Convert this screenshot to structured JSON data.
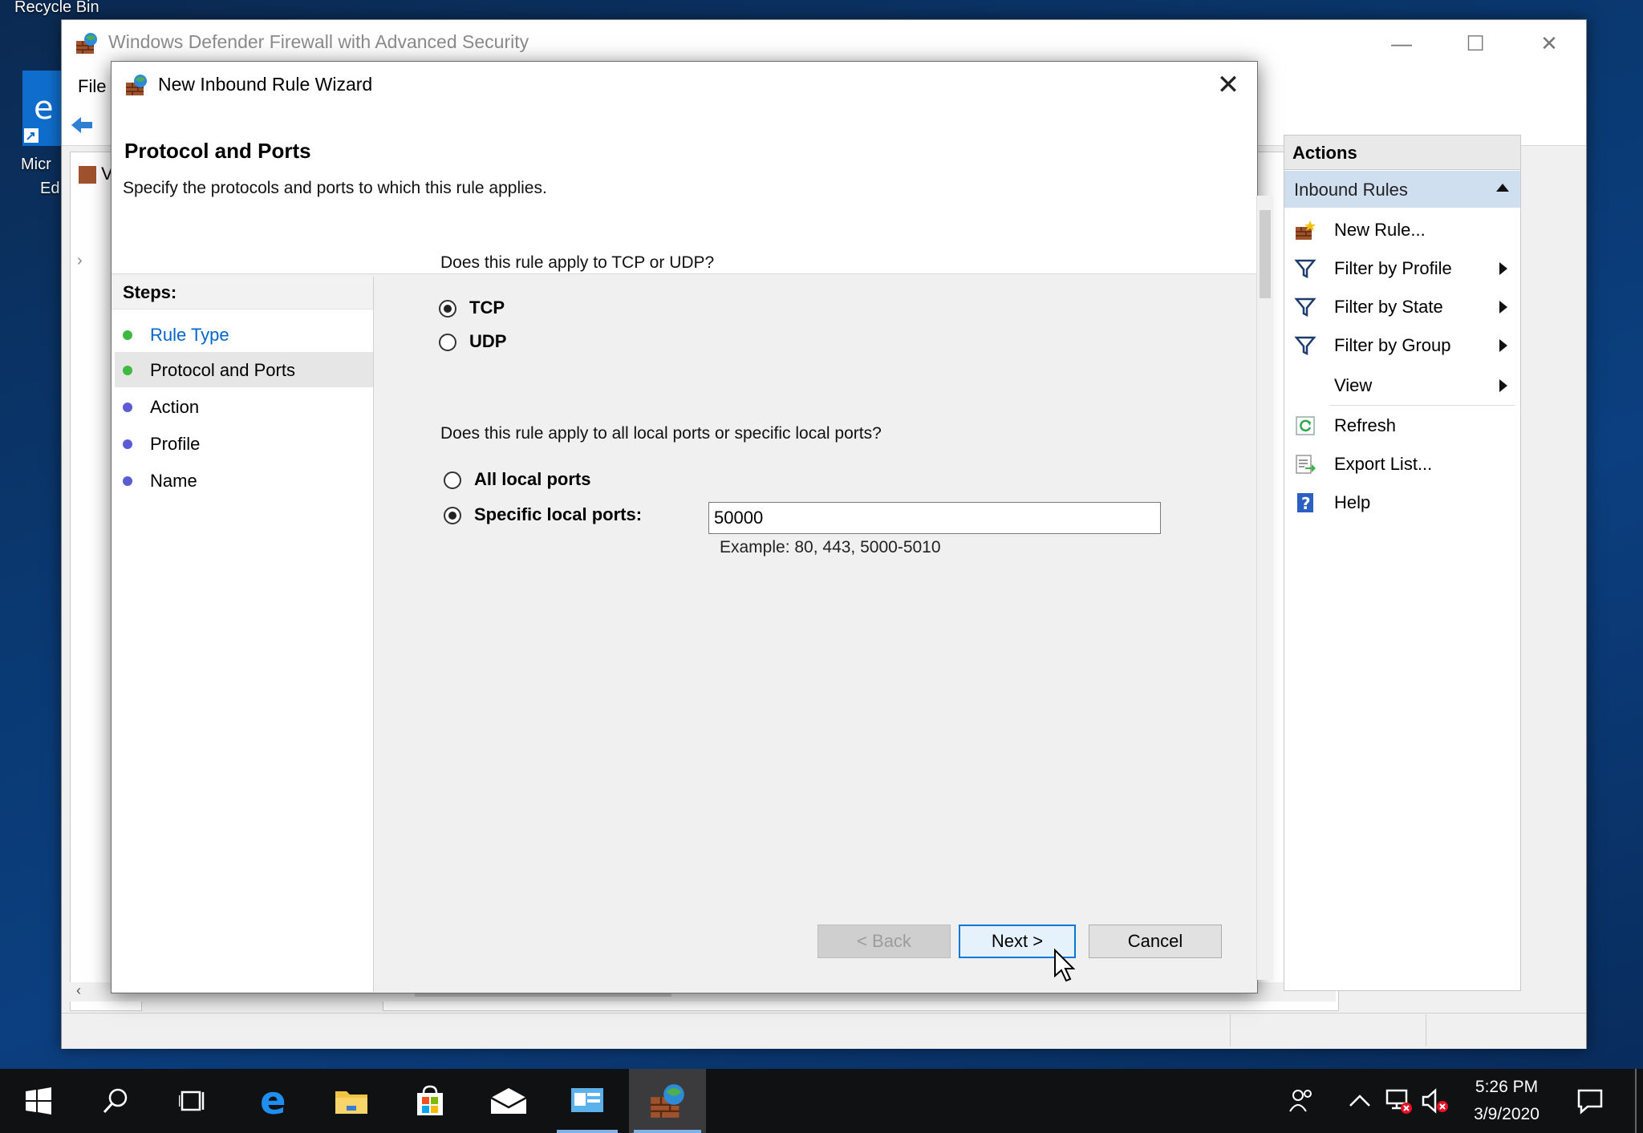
{
  "desktop": {
    "recycle_bin_label": "Recycle Bin",
    "edge_label_line1": "Micr",
    "edge_label_line2": "Ed"
  },
  "main_window": {
    "title": "Windows Defender Firewall with Advanced Security",
    "menu_file": "File",
    "tree_item_letter": "V"
  },
  "actions": {
    "header": "Actions",
    "section": "Inbound Rules",
    "items": [
      {
        "label": "New Rule...",
        "icon": "new-rule-icon",
        "submenu": false
      },
      {
        "label": "Filter by Profile",
        "icon": "funnel-icon",
        "submenu": true
      },
      {
        "label": "Filter by State",
        "icon": "funnel-icon",
        "submenu": true
      },
      {
        "label": "Filter by Group",
        "icon": "funnel-icon",
        "submenu": true
      },
      {
        "label": "View",
        "icon": "",
        "submenu": true
      },
      {
        "label": "Refresh",
        "icon": "refresh-icon",
        "submenu": false
      },
      {
        "label": "Export List...",
        "icon": "export-icon",
        "submenu": false
      },
      {
        "label": "Help",
        "icon": "help-icon",
        "submenu": false
      }
    ]
  },
  "wizard": {
    "title": "New Inbound Rule Wizard",
    "heading": "Protocol and Ports",
    "subheading": "Specify the protocols and ports to which this rule applies.",
    "steps_label": "Steps:",
    "steps": [
      {
        "label": "Rule Type",
        "state": "done"
      },
      {
        "label": "Protocol and Ports",
        "state": "current"
      },
      {
        "label": "Action",
        "state": "pending"
      },
      {
        "label": "Profile",
        "state": "pending"
      },
      {
        "label": "Name",
        "state": "pending"
      }
    ],
    "protocol_question": "Does this rule apply to TCP or UDP?",
    "protocol_options": [
      "TCP",
      "UDP"
    ],
    "protocol_selected": "TCP",
    "ports_question": "Does this rule apply to all local ports or specific local ports?",
    "port_options": [
      "All local ports",
      "Specific local ports:"
    ],
    "port_selected": "Specific local ports:",
    "ports_value": "50000",
    "ports_example": "Example: 80, 443, 5000-5010",
    "back_label": "< Back",
    "next_label": "Next >",
    "cancel_label": "Cancel"
  },
  "taskbar": {
    "time": "5:26 PM",
    "date": "3/9/2020"
  },
  "colors": {
    "accent": "#0078d7",
    "link_blue": "#0066cc",
    "step_done": "#3fb93f",
    "step_pending": "#5b5bd6",
    "actions_highlight": "#cfdff0"
  }
}
